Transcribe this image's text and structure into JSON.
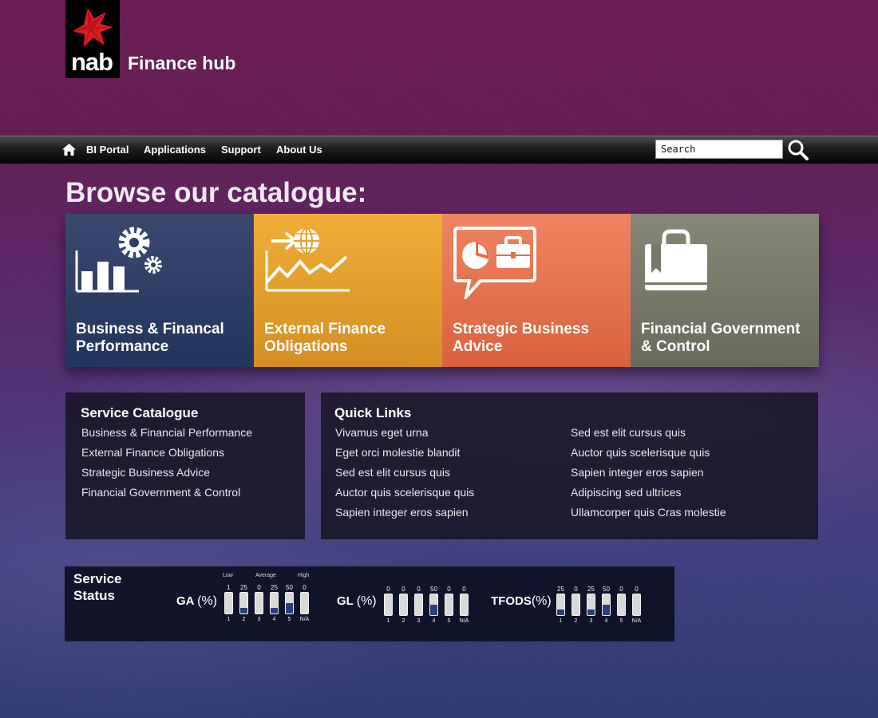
{
  "header": {
    "logo_text": "nab",
    "title": "Finance hub"
  },
  "nav": {
    "items": [
      {
        "label": "BI Portal"
      },
      {
        "label": "Applications"
      },
      {
        "label": "Support"
      },
      {
        "label": "About Us"
      }
    ],
    "search": {
      "placeholder": "Search"
    }
  },
  "browse": {
    "title": "Browse our catalogue:"
  },
  "tiles": [
    {
      "label": "Business & Financal Performance",
      "icon": "chart-gears-icon",
      "color": "#2a3b63"
    },
    {
      "label": "External Finance Obligations",
      "icon": "globe-trend-icon",
      "color": "#e29e2b"
    },
    {
      "label": "Strategic Business Advice",
      "icon": "briefcase-chat-icon",
      "color": "#e56f49"
    },
    {
      "label": "Financial Government & Control",
      "icon": "shopping-bag-icon",
      "color": "#777766"
    }
  ],
  "service_catalogue": {
    "title": "Service Catalogue",
    "items": [
      "Business & Financial Performance",
      "External Finance Obligations",
      "Strategic Business Advice",
      "Financial Government & Control"
    ]
  },
  "quick_links": {
    "title": "Quick Links",
    "col1": [
      "Vivamus eget urna",
      "Eget orci molestie blandit",
      "Sed est elit cursus quis",
      "Auctor quis scelerisque quis",
      "Sapien integer eros sapien"
    ],
    "col2": [
      "Sed est elit cursus quis",
      "Auctor quis scelerisque quis",
      "Sapien integer eros sapien",
      "Adipiscing sed ultrices",
      "Ullamcorper quis Cras molestie"
    ]
  },
  "service_status": {
    "title_line1": "Service",
    "title_line2": "Status",
    "legend": {
      "low": "Low",
      "average": "Average",
      "high": "High"
    },
    "metrics": [
      {
        "name": "GA",
        "unit": "(%)",
        "gauges": [
          {
            "top": "1",
            "bottom": "1",
            "level": 0
          },
          {
            "top": "25",
            "bottom": "2",
            "level": 0.25
          },
          {
            "top": "0",
            "bottom": "3",
            "level": 0
          },
          {
            "top": "25",
            "bottom": "4",
            "level": 0.25
          },
          {
            "top": "50",
            "bottom": "5",
            "level": 0.5
          },
          {
            "top": "0",
            "bottom": "N/A",
            "level": 0
          }
        ]
      },
      {
        "name": "GL",
        "unit": "(%)",
        "gauges": [
          {
            "top": "0",
            "bottom": "1",
            "level": 0
          },
          {
            "top": "0",
            "bottom": "2",
            "level": 0
          },
          {
            "top": "0",
            "bottom": "3",
            "level": 0
          },
          {
            "top": "50",
            "bottom": "4",
            "level": 0.5
          },
          {
            "top": "0",
            "bottom": "5",
            "level": 0
          },
          {
            "top": "0",
            "bottom": "N/A",
            "level": 0
          }
        ]
      },
      {
        "name": "TFODS",
        "unit": "(%)",
        "gauges": [
          {
            "top": "25",
            "bottom": "1",
            "level": 0.25
          },
          {
            "top": "0",
            "bottom": "2",
            "level": 0
          },
          {
            "top": "25",
            "bottom": "3",
            "level": 0.25
          },
          {
            "top": "50",
            "bottom": "4",
            "level": 0.5
          },
          {
            "top": "0",
            "bottom": "5",
            "level": 0
          },
          {
            "top": "0",
            "bottom": "N/A",
            "level": 0
          }
        ]
      }
    ]
  }
}
